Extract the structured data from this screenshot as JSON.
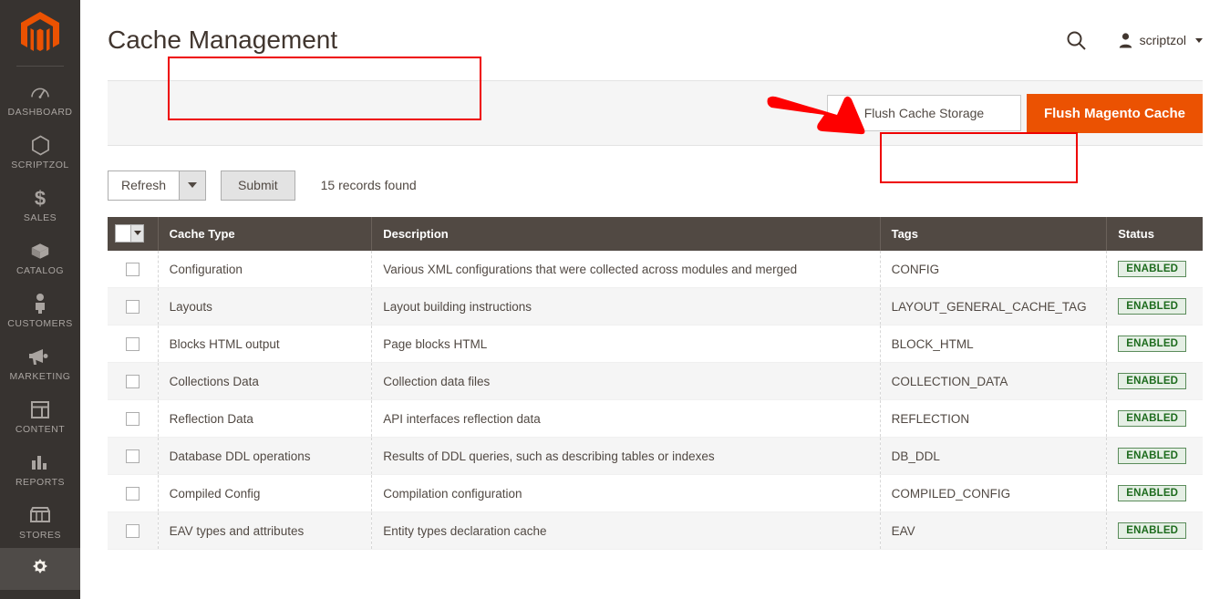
{
  "app": {
    "logo_icon": "magento-logo-icon",
    "brand_color": "#eb5202"
  },
  "sidebar": {
    "items": [
      {
        "label": "DASHBOARD",
        "icon": "dashboard-icon",
        "active": false
      },
      {
        "label": "SCRIPTZOL",
        "icon": "hexagon-icon",
        "active": false
      },
      {
        "label": "SALES",
        "icon": "dollar-icon",
        "active": false
      },
      {
        "label": "CATALOG",
        "icon": "box-icon",
        "active": false
      },
      {
        "label": "CUSTOMERS",
        "icon": "person-icon",
        "active": false
      },
      {
        "label": "MARKETING",
        "icon": "megaphone-icon",
        "active": false
      },
      {
        "label": "CONTENT",
        "icon": "layout-icon",
        "active": false
      },
      {
        "label": "REPORTS",
        "icon": "bar-chart-icon",
        "active": false
      },
      {
        "label": "STORES",
        "icon": "storefront-icon",
        "active": false
      },
      {
        "label": "",
        "icon": "gear-icon",
        "active": true
      }
    ]
  },
  "header": {
    "title": "Cache Management",
    "search_icon": "search-icon",
    "user_icon": "user-avatar-icon",
    "user_name": "scriptzol",
    "caret_icon": "chevron-down-icon"
  },
  "button_bar": {
    "flush_cache_storage": "Flush Cache Storage",
    "flush_magento_cache": "Flush Magento Cache"
  },
  "toolbar": {
    "action_selected": "Refresh",
    "action_caret_icon": "chevron-down-icon",
    "submit_label": "Submit",
    "records_found": "15 records found"
  },
  "grid": {
    "mass_select_icon": "mass-select-chevron-icon",
    "columns": [
      "Cache Type",
      "Description",
      "Tags",
      "Status"
    ],
    "rows": [
      {
        "cache_type": "Configuration",
        "description": "Various XML configurations that were collected across modules and merged",
        "tags": "CONFIG",
        "status": "ENABLED"
      },
      {
        "cache_type": "Layouts",
        "description": "Layout building instructions",
        "tags": "LAYOUT_GENERAL_CACHE_TAG",
        "status": "ENABLED"
      },
      {
        "cache_type": "Blocks HTML output",
        "description": "Page blocks HTML",
        "tags": "BLOCK_HTML",
        "status": "ENABLED"
      },
      {
        "cache_type": "Collections Data",
        "description": "Collection data files",
        "tags": "COLLECTION_DATA",
        "status": "ENABLED"
      },
      {
        "cache_type": "Reflection Data",
        "description": "API interfaces reflection data",
        "tags": "REFLECTION",
        "status": "ENABLED"
      },
      {
        "cache_type": "Database DDL operations",
        "description": "Results of DDL queries, such as describing tables or indexes",
        "tags": "DB_DDL",
        "status": "ENABLED"
      },
      {
        "cache_type": "Compiled Config",
        "description": "Compilation configuration",
        "tags": "COMPILED_CONFIG",
        "status": "ENABLED"
      },
      {
        "cache_type": "EAV types and attributes",
        "description": "Entity types declaration cache",
        "tags": "EAV",
        "status": "ENABLED"
      }
    ]
  },
  "annotations": {
    "highlight_color": "#ee0000",
    "arrow_icon": "red-arrow-icon",
    "title_box": "Cache Management",
    "button_box": "Flush Cache Storage"
  }
}
